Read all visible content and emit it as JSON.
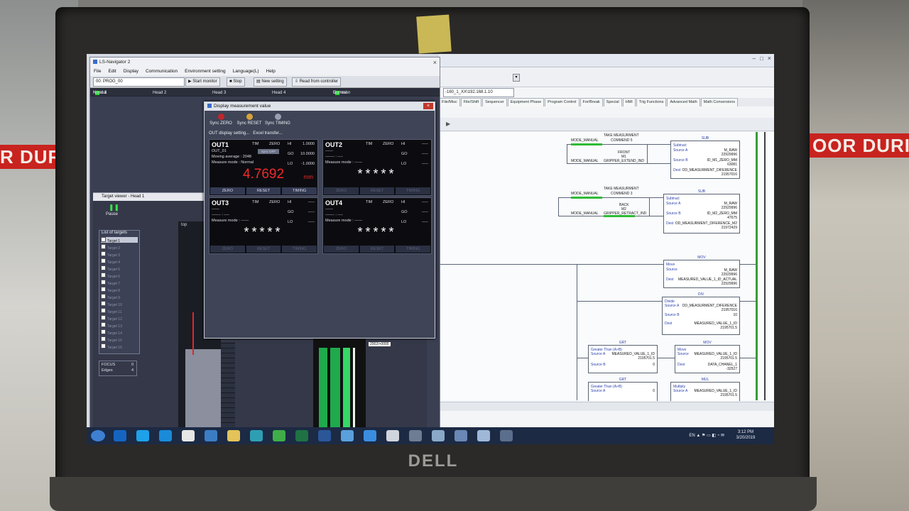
{
  "photo": {
    "sign_left": "R DURIN",
    "sign_right": "OOR DURING OPE",
    "laptop_brand": "DELL"
  },
  "ls_navigator": {
    "title": "LS-Navigator 2",
    "menu": [
      "File",
      "Edit",
      "Display",
      "Communication",
      "Environment setting",
      "Language(L)",
      "Help"
    ],
    "program": "00: PROG_00",
    "toolbar": {
      "start_monitor": "Start monitor",
      "stop": "Stop",
      "new_setting": "New setting",
      "read_from_controller": "Read from controller"
    },
    "heads": [
      {
        "label": "Head 1",
        "status": "Normal"
      },
      {
        "label": "Head 2",
        "status": ""
      },
      {
        "label": "Head 3",
        "status": ""
      },
      {
        "label": "Head 4",
        "status": ""
      },
      {
        "label": "Common",
        "status": "Normal"
      }
    ]
  },
  "target_viewer": {
    "title": "Target viewer - Head 1",
    "pause": "Pause",
    "list_title": "List of targets",
    "targets": [
      "Target 1",
      "Target 2",
      "Target 3",
      "Target 4",
      "Target 5",
      "Target 6",
      "Target 7",
      "Target 8",
      "Target 9",
      "Target 10",
      "Target 11",
      "Target 12",
      "Target 13",
      "Target 14",
      "Target 15",
      "Target 16"
    ],
    "focus_label": "FOCUS",
    "focus_value": "0",
    "edges_label": "Edges",
    "edges_value": "4",
    "top_label": "top",
    "cursor_readout": "2002/+0000"
  },
  "dmv": {
    "title": "Display measurement value",
    "sync_zero": "Sync ZERO",
    "sync_reset": "Sync RESET",
    "sync_timing": "Sync TIMING",
    "out_display_setting": "OUT display setting...",
    "excel_transfer": "Excel transfer...",
    "panels": [
      {
        "name": "OUT1",
        "sub": "OUT_01",
        "moving_average": "Moving average : 2048",
        "measure_mode": "Measure mode : Normal",
        "hi": "1.0000",
        "go": "10.0000",
        "lo": "-1.0000",
        "value": "4.7692",
        "unit": "mm",
        "sync_off": "Sync OFF"
      },
      {
        "name": "OUT2",
        "sub": "------",
        "moving_average": "------- : ----",
        "measure_mode": "Measure mode : ------",
        "hi": "-----",
        "go": "-----",
        "lo": "-----",
        "value": "*****"
      },
      {
        "name": "OUT3",
        "sub": "------",
        "moving_average": "------- : ----",
        "measure_mode": "Measure mode : ------",
        "hi": "-----",
        "go": "-----",
        "lo": "-----",
        "value": "*****"
      },
      {
        "name": "OUT4",
        "sub": "------",
        "moving_average": "------- : ----",
        "measure_mode": "Measure mode : ------",
        "hi": "-----",
        "go": "-----",
        "lo": "-----",
        "value": "*****"
      }
    ],
    "status_labels": {
      "tim": "TIM",
      "zero": "ZERO",
      "hi": "HI",
      "go": "GO",
      "lo": "LO"
    },
    "buttons": [
      "ZERO",
      "RESET",
      "TIMING"
    ]
  },
  "logix": {
    "path": "-160_1_XX\\192.168.1.10",
    "tabs": [
      "File/Misc",
      "File/Shift",
      "Sequencer",
      "Equipment Phase",
      "Program Control",
      "For/Break",
      "Special",
      "HMI",
      "Trig Functions",
      "Advanced Math",
      "Math Conversions"
    ],
    "rungs": {
      "take_meas_5": "TAKE MEASURMENT",
      "commend_5": "COMMEND 5",
      "take_meas_3": "TAKE MEASURMENT",
      "commend_3": "COMMEND 3",
      "mode_manual": "MODE_MANUAL",
      "front": "FRONT",
      "m1": "M1",
      "gripper_extend": "GRIPPER_EXTEND_IND",
      "back": "BACK",
      "m2": "M2",
      "gripper_retract": "GRIPPER_RETRACT_IND"
    },
    "boxes": {
      "sub1": {
        "type": "SUB",
        "title": "Subtract",
        "a_label": "Source A",
        "a_tag": "M_RAW",
        "a_val": "22929996",
        "b_label": "Source B",
        "b_tag": "ID_M1_ZERO_MM",
        "b_val": "63081",
        "d_label": "Dest",
        "d_tag": "OD_MEASURMENT_DIFERENCE",
        "d_val": "21957016"
      },
      "sub2": {
        "type": "SUB",
        "title": "Subtract",
        "a_label": "Source A",
        "a_tag": "M_RAW",
        "a_val": "22929996",
        "b_label": "Source B",
        "b_tag": "ID_M2_ZERO_MM",
        "b_val": "47675",
        "d_label": "Dest",
        "d_tag": "OD_MEASURMENT_DIFERENCE_M2",
        "d_val": "21972429"
      },
      "mov1": {
        "type": "MOV",
        "title": "Move",
        "a_label": "Source",
        "a_tag": "M_RAW",
        "a_val": "22929996",
        "d_label": "Dest",
        "d_tag": "MEASURED_VALUE_1_ID_ACTUAL",
        "d_val": "22929996"
      },
      "div1": {
        "type": "DIV",
        "title": "Divide",
        "a_label": "Source A",
        "a_tag": "OD_MEASURMENT_DIFERENCE",
        "a_val": "21957016",
        "b_label": "Source B",
        "b_val": "10",
        "d_label": "Dest",
        "d_tag": "MEASURED_VALUE_1_ID",
        "d_val": "2195701.5"
      },
      "grt1": {
        "type": "GRT",
        "title": "Greater Than (A>B)",
        "a_label": "Source A",
        "a_tag": "MEASURED_VALUE_1_ID",
        "a_val": "2195701.5",
        "b_label": "Source B",
        "b_val": "0"
      },
      "mov2": {
        "type": "MOV",
        "title": "Move",
        "a_label": "Source",
        "a_tag": "MEASURED_VALUE_1_ID",
        "a_val": "2195701.5",
        "d_label": "Dest",
        "d_tag": "DATA_CHANEL_1",
        "d_val": "-32527"
      },
      "grt2": {
        "type": "GRT",
        "title": "Greater Than (A>B)",
        "a_label": "Source A",
        "a_val": "0"
      },
      "mul1": {
        "type": "MUL",
        "title": "Multiply",
        "a_label": "Source A",
        "a_tag": "MEASURED_VALUE_1_ID",
        "a_val": "2195701.5"
      }
    }
  },
  "taskbar": {
    "tray_lang": "EN",
    "time": "3:12 PM",
    "date": "3/20/2019"
  }
}
